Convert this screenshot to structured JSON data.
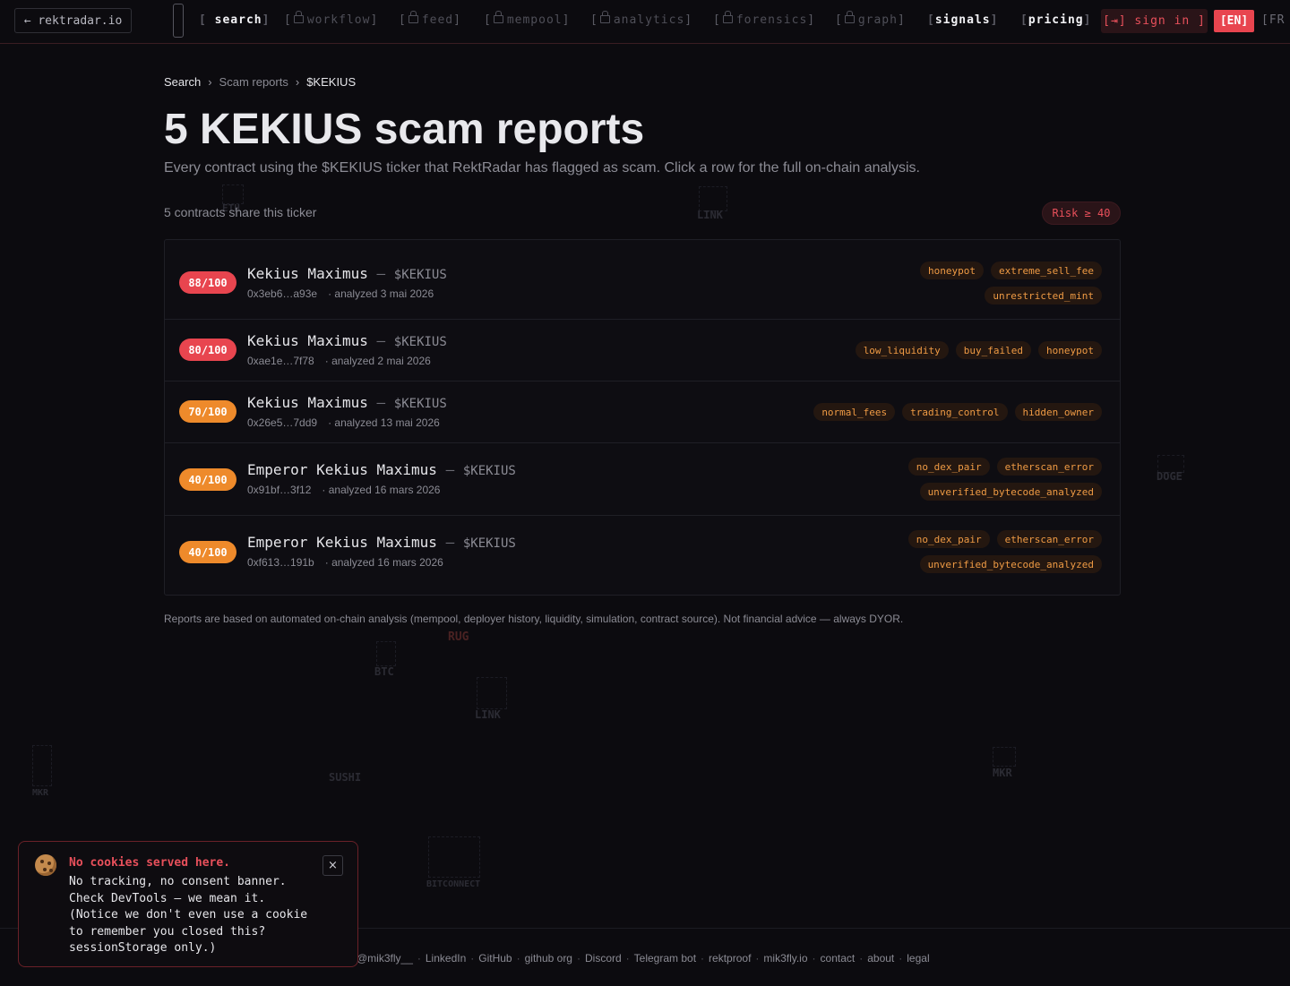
{
  "nav": {
    "home_label": "← rektradar.io",
    "items": [
      {
        "label": "search",
        "locked": false
      },
      {
        "label": "workflow",
        "locked": true
      },
      {
        "label": "feed",
        "locked": true
      },
      {
        "label": "mempool",
        "locked": true
      },
      {
        "label": "analytics",
        "locked": true
      },
      {
        "label": "forensics",
        "locked": true
      },
      {
        "label": "graph",
        "locked": true
      },
      {
        "label": "signals",
        "locked": false
      },
      {
        "label": "pricing",
        "locked": false
      }
    ],
    "sign_in_label": "[⇥] sign in ]",
    "lang_active": "[EN]",
    "lang_other": "[FR"
  },
  "breadcrumb": [
    "Search",
    "Scam reports",
    "$KEKIUS"
  ],
  "page": {
    "title": "5 KEKIUS scam reports",
    "subtitle": "Every contract using the $KEKIUS ticker that RektRadar has flagged as scam. Click a row for the full on-chain analysis.",
    "count_text": "5 contracts share this ticker",
    "risk_filter": "Risk ≥ 40"
  },
  "reports": [
    {
      "score": "88/100",
      "level": "red",
      "name": "Kekius Maximus",
      "ticker": "$KEKIUS",
      "address": "0x3eb6…a93e",
      "analyzed": "· analyzed 3 mai 2026",
      "tags": [
        "honeypot",
        "extreme_sell_fee",
        "unrestricted_mint"
      ]
    },
    {
      "score": "80/100",
      "level": "red",
      "name": "Kekius Maximus",
      "ticker": "$KEKIUS",
      "address": "0xae1e…7f78",
      "analyzed": "· analyzed 2 mai 2026",
      "tags": [
        "low_liquidity",
        "buy_failed",
        "honeypot"
      ]
    },
    {
      "score": "70/100",
      "level": "orange",
      "name": "Kekius Maximus",
      "ticker": "$KEKIUS",
      "address": "0x26e5…7dd9",
      "analyzed": "· analyzed 13 mai 2026",
      "tags": [
        "normal_fees",
        "trading_control",
        "hidden_owner"
      ]
    },
    {
      "score": "40/100",
      "level": "orange",
      "name": "Emperor Kekius Maximus",
      "ticker": "$KEKIUS",
      "address": "0x91bf…3f12",
      "analyzed": "· analyzed 16 mars 2026",
      "tags": [
        "no_dex_pair",
        "etherscan_error",
        "unverified_bytecode_analyzed"
      ]
    },
    {
      "score": "40/100",
      "level": "orange",
      "name": "Emperor Kekius Maximus",
      "ticker": "$KEKIUS",
      "address": "0xf613…191b",
      "analyzed": "· analyzed 16 mars 2026",
      "tags": [
        "no_dex_pair",
        "etherscan_error",
        "unverified_bytecode_analyzed"
      ]
    }
  ],
  "disclaimer": "Reports are based on automated on-chain analysis (mempool, deployer history, liquidity, simulation, contract source). Not financial advice — always DYOR.",
  "footer_links": [
    "@mik3fly__",
    "LinkedIn",
    "GitHub",
    "github org",
    "Discord",
    "Telegram bot",
    "rektproof",
    "mik3fly.io",
    "contact",
    "about",
    "legal"
  ],
  "cookie": {
    "title": "No cookies served here.",
    "body": "No tracking, no consent banner.\nCheck DevTools — we mean it.\n(Notice we don't even use a cookie\nto remember you closed this?\nsessionStorage only.)",
    "close": "×"
  },
  "background_tickers": [
    "ETH",
    "LINK",
    "DOGE",
    "RUG",
    "BTC",
    "LINK",
    "MKR",
    "SUSHI",
    "MKR",
    "BITCONNECT"
  ],
  "colors": {
    "accent_red": "#e8454f",
    "accent_orange": "#ee8a2b",
    "tag_text": "#ee9a44"
  }
}
